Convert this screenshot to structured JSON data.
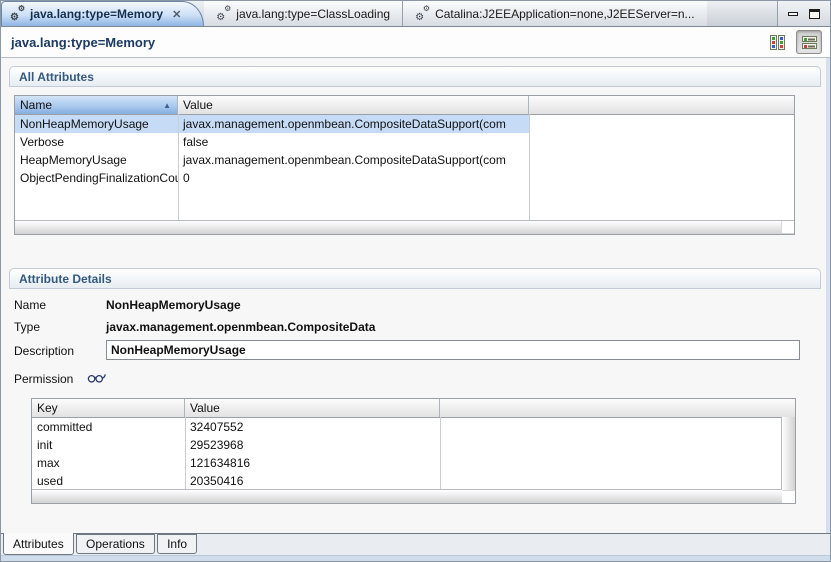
{
  "icons": {
    "gear": "⚙",
    "close": "✕",
    "sort_asc": "▲"
  },
  "colors": {
    "active_tab_top": "#f3f8fe",
    "active_tab_bottom": "#8fb4e4",
    "selection_row": "#c6dcf6",
    "sorted_header": "#a7c6ec",
    "section_title_text": "#33597e",
    "frame_blue": "#d5e1f0"
  },
  "tabbar": {
    "tabs": [
      {
        "label": "java.lang:type=Memory",
        "state": "active",
        "closable": true
      },
      {
        "label": "java.lang:type=ClassLoading",
        "state": "inactive"
      },
      {
        "label": "Catalina:J2EEApplication=none,J2EEServer=n...",
        "state": "inactive"
      }
    ]
  },
  "header": {
    "title": "java.lang:type=Memory"
  },
  "all_attributes": {
    "section_title": "All Attributes",
    "columns": [
      "Name",
      "Value"
    ],
    "rows": [
      {
        "name": "NonHeapMemoryUsage",
        "value": "javax.management.openmbean.CompositeDataSupport(com",
        "selected": true
      },
      {
        "name": "Verbose",
        "value": "false",
        "selected": false
      },
      {
        "name": "HeapMemoryUsage",
        "value": "javax.management.openmbean.CompositeDataSupport(com",
        "selected": false
      },
      {
        "name": "ObjectPendingFinalizationCount",
        "value": "0",
        "selected": false
      }
    ]
  },
  "attribute_details": {
    "section_title": "Attribute Details",
    "name_label": "Name",
    "name_value": "NonHeapMemoryUsage",
    "type_label": "Type",
    "type_value": "javax.management.openmbean.CompositeData",
    "description_label": "Description",
    "description_value": "NonHeapMemoryUsage",
    "permission_label": "Permission",
    "composite": {
      "columns": [
        "Key",
        "Value"
      ],
      "rows": [
        {
          "key": "committed",
          "value": "32407552"
        },
        {
          "key": "init",
          "value": "29523968"
        },
        {
          "key": "max",
          "value": "121634816"
        },
        {
          "key": "used",
          "value": "20350416"
        }
      ]
    }
  },
  "bottom_tabs": [
    {
      "label": "Attributes",
      "state": "active"
    },
    {
      "label": "Operations",
      "state": "inactive"
    },
    {
      "label": "Info",
      "state": "inactive"
    }
  ]
}
